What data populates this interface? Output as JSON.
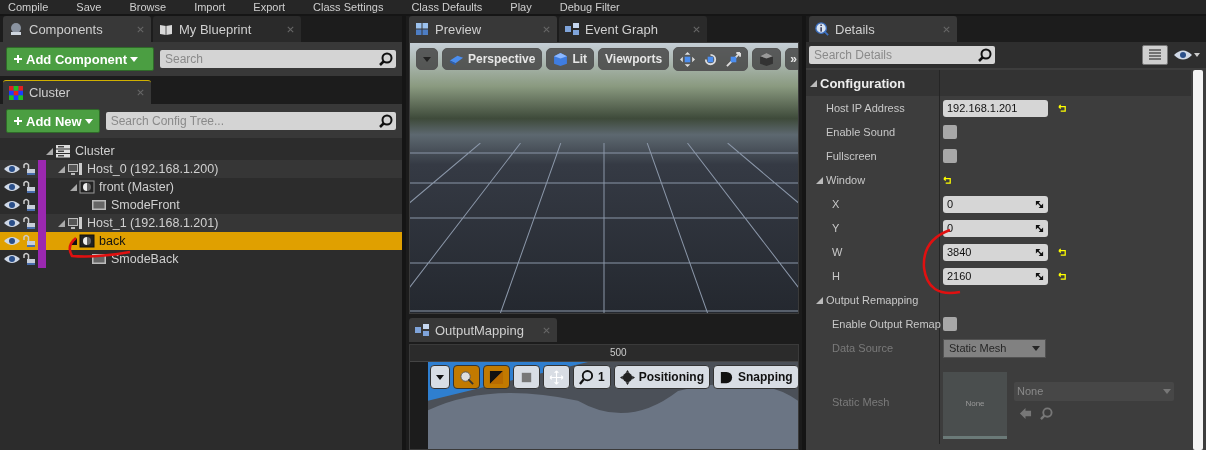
{
  "toolbar": [
    "Compile",
    "Save",
    "Browse",
    "Import",
    "Export",
    "Class Settings",
    "Class Defaults",
    "Play",
    "Debug Filter"
  ],
  "left_tabs": [
    {
      "label": "Components",
      "selected": true
    },
    {
      "label": "My Blueprint",
      "selected": false
    }
  ],
  "components_toolbar": {
    "add_button": "Add Component",
    "search": {
      "placeholder": "Search"
    }
  },
  "cluster_tab": {
    "label": "Cluster"
  },
  "cluster_toolbar": {
    "add_button": "Add New",
    "search": {
      "placeholder": "Search Config Tree..."
    }
  },
  "tree": [
    {
      "label": "Cluster",
      "kind": "cluster",
      "expanded": true,
      "selected": false,
      "children": [
        {
          "label": "Host_0 (192.168.1.200)",
          "kind": "host",
          "expanded": true,
          "selected": false,
          "visible": true,
          "locked": false,
          "children": [
            {
              "label": "front (Master)",
              "kind": "viewport",
              "expanded": true,
              "selected": false,
              "visible": true,
              "locked": false,
              "children": [
                {
                  "label": "SmodeFront",
                  "kind": "screen",
                  "selected": false,
                  "visible": true,
                  "locked": false
                }
              ]
            }
          ]
        },
        {
          "label": "Host_1 (192.168.1.201)",
          "kind": "host",
          "expanded": true,
          "selected": false,
          "visible": true,
          "locked": false,
          "children": [
            {
              "label": "back",
              "kind": "viewport",
              "expanded": true,
              "selected": true,
              "visible": true,
              "locked": false,
              "children": [
                {
                  "label": "SmodeBack",
                  "kind": "screen",
                  "selected": false,
                  "visible": true,
                  "locked": false
                }
              ]
            }
          ]
        }
      ]
    }
  ],
  "middle_tabs": [
    {
      "label": "Preview",
      "selected": true
    },
    {
      "label": "Event Graph",
      "selected": false
    }
  ],
  "viewport_toolbar": [
    {
      "kind": "menu"
    },
    {
      "kind": "perspective",
      "label": "Perspective"
    },
    {
      "kind": "lit",
      "label": "Lit"
    },
    {
      "kind": "text",
      "label": "Viewports"
    },
    {
      "kind": "transform"
    },
    {
      "kind": "camera"
    },
    {
      "kind": "overflow",
      "label": "»"
    }
  ],
  "output_tab": {
    "label": "OutputMapping"
  },
  "output_ruler": [
    "500"
  ],
  "output_toolbar": [
    {
      "kind": "menu",
      "on": false
    },
    {
      "kind": "help-zoom",
      "on": true
    },
    {
      "kind": "color",
      "on": true
    },
    {
      "kind": "square",
      "on": false
    },
    {
      "kind": "fit",
      "on": false
    },
    {
      "kind": "zoom",
      "label": "1",
      "on": false
    },
    {
      "kind": "positioning",
      "label": "Positioning",
      "on": false
    },
    {
      "kind": "snapping",
      "label": "Snapping",
      "on": false
    }
  ],
  "details_tab": {
    "label": "Details"
  },
  "details_search": {
    "placeholder": "Search Details"
  },
  "properties": [
    {
      "kind": "category",
      "label": "Configuration",
      "expanded": true,
      "children": [
        {
          "kind": "text",
          "label": "Host IP Address",
          "value": "192.168.1.201",
          "reset": true,
          "disabled": false
        },
        {
          "kind": "checkbox",
          "label": "Enable Sound",
          "checked": false,
          "disabled": false
        },
        {
          "kind": "checkbox",
          "label": "Fullscreen",
          "checked": false,
          "disabled": false
        },
        {
          "kind": "group",
          "label": "Window",
          "expanded": true,
          "reset": true,
          "children": [
            {
              "kind": "number",
              "label": "X",
              "value": "0",
              "disabled": false
            },
            {
              "kind": "number",
              "label": "Y",
              "value": "0",
              "disabled": false
            },
            {
              "kind": "number",
              "label": "W",
              "value": "3840",
              "reset": true,
              "disabled": false
            },
            {
              "kind": "number",
              "label": "H",
              "value": "2160",
              "reset": true,
              "disabled": false
            }
          ]
        },
        {
          "kind": "group",
          "label": "Output Remapping",
          "expanded": true,
          "children": [
            {
              "kind": "checkbox",
              "label": "Enable Output Remap",
              "checked": false,
              "disabled": false
            },
            {
              "kind": "dropdown",
              "label": "Data Source",
              "value": "Static Mesh",
              "disabled": true
            },
            {
              "kind": "asset",
              "label": "Static Mesh",
              "thumbnail": "None",
              "value": "None",
              "disabled": true
            }
          ]
        }
      ]
    }
  ]
}
